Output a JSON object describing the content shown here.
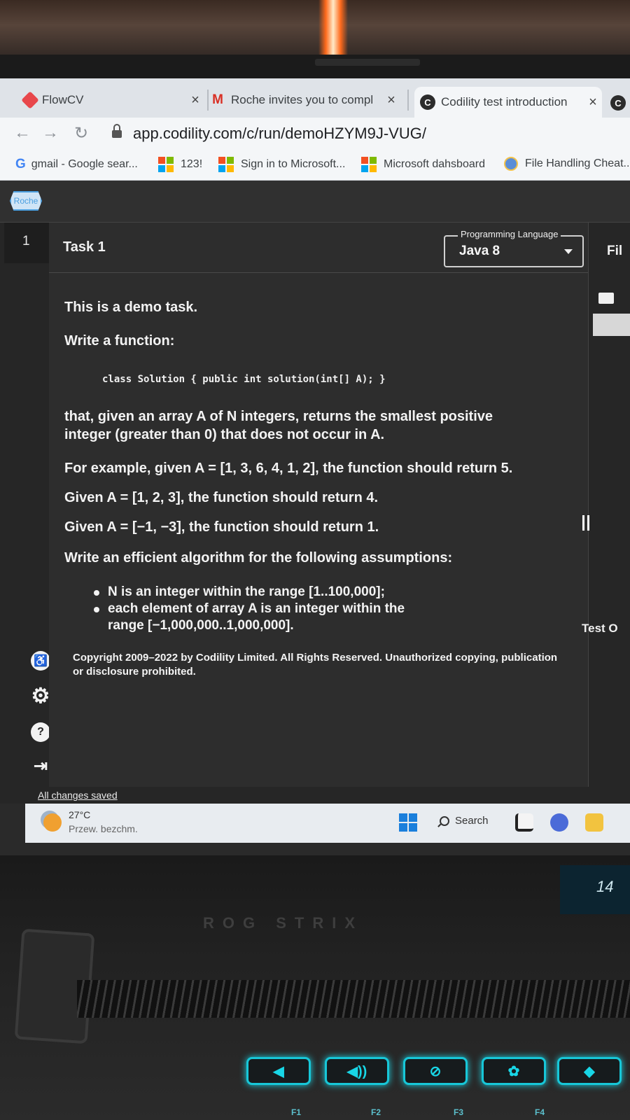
{
  "browser": {
    "tabs": [
      {
        "title": "FlowCV",
        "close": "×"
      },
      {
        "title": "Roche invites you to compl",
        "close": "×"
      },
      {
        "title": "Codility test introduction",
        "close": "×"
      }
    ],
    "url": "app.codility.com/c/run/demoHZYM9J-VUG/",
    "bookmarks": [
      "gmail - Google sear...",
      "123!",
      "Sign in to Microsoft...",
      "Microsoft dahsboard",
      "File Handling Cheat..."
    ]
  },
  "app": {
    "logo_text": "Roche",
    "task_number": "1",
    "task_title": "Task 1",
    "language_legend": "Programming Language",
    "language_value": "Java 8",
    "right_panel_label": "Fil",
    "test_label": "Test O",
    "status": "All changes saved"
  },
  "task": {
    "intro": "This is a demo task.",
    "write_function": "Write a function:",
    "code": "class Solution { public int solution(int[] A); }",
    "description": "that, given an array A of N integers, returns the smallest positive integer (greater than 0) that does not occur in A.",
    "example1": "For example, given A = [1, 3, 6, 4, 1, 2], the function should return 5.",
    "example2": "Given A = [1, 2, 3], the function should return 4.",
    "example3": "Given A = [−1, −3], the function should return 1.",
    "assumptions_heading": "Write an efficient algorithm for the following assumptions:",
    "assumptions": [
      "N is an integer within the range [1..100,000];",
      "each element of array A is an integer within the range [−1,000,000..1,000,000]."
    ],
    "copyright": "Copyright 2009–2022 by Codility Limited. All Rights Reserved. Unauthorized copying, publication or disclosure prohibited."
  },
  "taskbar": {
    "temperature": "27°C",
    "weather": "Przew. bezchm.",
    "search": "Search"
  },
  "laptop": {
    "brand": "ROG STRIX",
    "clock_fragment": "14",
    "fkeys": [
      "F1",
      "F2",
      "F3",
      "F4"
    ]
  }
}
